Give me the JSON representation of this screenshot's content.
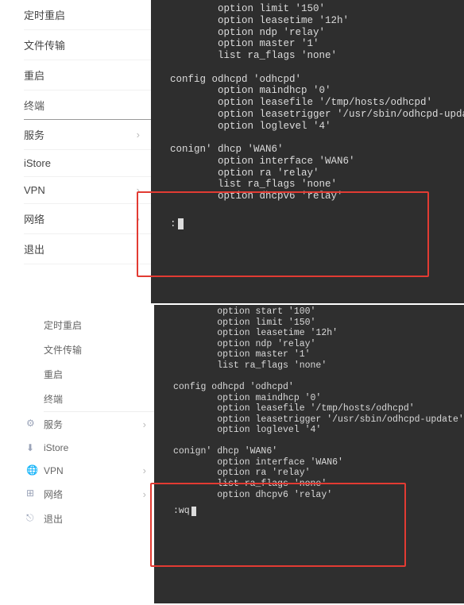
{
  "panel1": {
    "sidebar": [
      {
        "label": "定时重启",
        "chev": false
      },
      {
        "label": "文件传输",
        "chev": false
      },
      {
        "label": "重启",
        "chev": false
      },
      {
        "label": "终端",
        "chev": false,
        "sel": true
      },
      {
        "label": "服务",
        "chev": true
      },
      {
        "label": "iStore",
        "chev": false
      },
      {
        "label": "VPN",
        "chev": true
      },
      {
        "label": "网络",
        "chev": true
      },
      {
        "label": "退出",
        "chev": false
      }
    ],
    "code_lines": [
      "        option limit '150'",
      "        option leasetime '12h'",
      "        option ndp 'relay'",
      "        option master '1'",
      "        list ra_flags 'none'",
      "",
      "config odhcpd 'odhcpd'",
      "        option maindhcp '0'",
      "        option leasefile '/tmp/hosts/odhcpd'",
      "        option leasetrigger '/usr/sbin/odhcpd-update'",
      "        option loglevel '4'",
      "",
      "conign' dhcp 'WAN6'",
      "        option interface 'WAN6'",
      "        option ra 'relay'",
      "        list ra_flags 'none'",
      "        option dhcpv6 'relay'"
    ],
    "cmdline": ":"
  },
  "panel2": {
    "sidebar": [
      {
        "label": "定时重启",
        "chev": false,
        "icon": ""
      },
      {
        "label": "文件传输",
        "chev": false,
        "icon": ""
      },
      {
        "label": "重启",
        "chev": false,
        "icon": ""
      },
      {
        "label": "终端",
        "chev": false,
        "icon": "",
        "sel": true
      },
      {
        "label": "服务",
        "chev": true,
        "icon": "⚙",
        "iconName": "gear-icon"
      },
      {
        "label": "iStore",
        "chev": false,
        "icon": "⬇",
        "iconName": "download-icon"
      },
      {
        "label": "VPN",
        "chev": true,
        "icon": "🌐",
        "iconName": "globe-icon"
      },
      {
        "label": "网络",
        "chev": true,
        "icon": "⊞",
        "iconName": "network-icon"
      },
      {
        "label": "退出",
        "chev": false,
        "icon": "⎋",
        "iconName": "exit-icon"
      }
    ],
    "code_lines": [
      "        option start '100'",
      "        option limit '150'",
      "        option leasetime '12h'",
      "        option ndp 'relay'",
      "        option master '1'",
      "        list ra_flags 'none'",
      "",
      "config odhcpd 'odhcpd'",
      "        option maindhcp '0'",
      "        option leasefile '/tmp/hosts/odhcpd'",
      "        option leasetrigger '/usr/sbin/odhcpd-update'",
      "        option loglevel '4'",
      "",
      "conign' dhcp 'WAN6'",
      "        option interface 'WAN6'",
      "        option ra 'relay'",
      "        list ra_flags 'none'",
      "        option dhcpv6 'relay'"
    ],
    "cmdline": ":wq"
  }
}
